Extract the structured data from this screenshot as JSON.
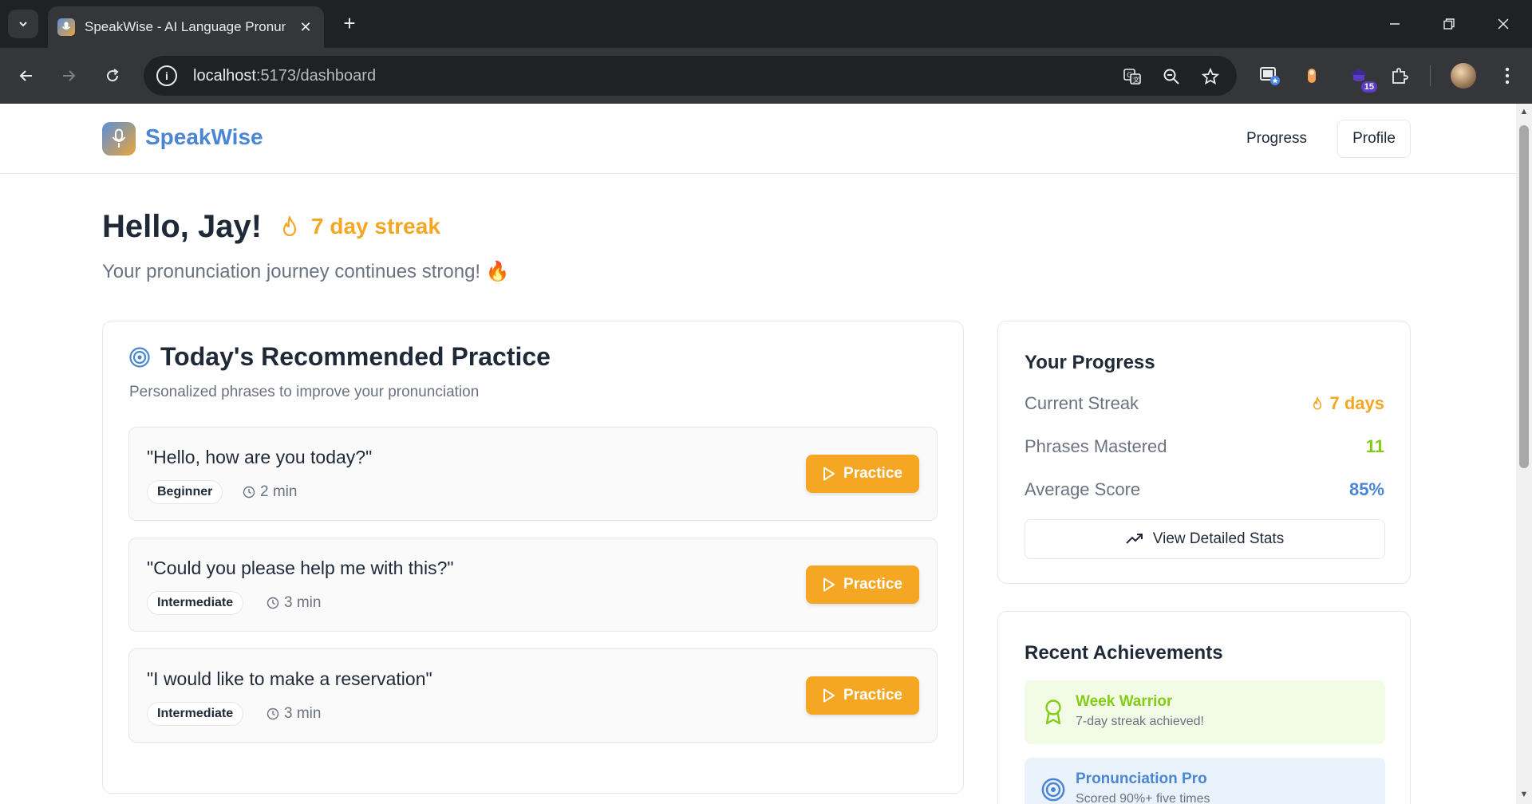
{
  "browser": {
    "tab_title": "SpeakWise - AI Language Pronunciation",
    "url_host": "localhost",
    "url_rest": ":5173/dashboard",
    "extension_badge": "15"
  },
  "header": {
    "brand": "SpeakWise",
    "nav": {
      "progress": "Progress",
      "profile": "Profile"
    }
  },
  "greeting": {
    "hello": "Hello, Jay!",
    "streak": "7 day streak",
    "subtitle": "Your pronunciation journey continues strong! 🔥"
  },
  "practice": {
    "title": "Today's Recommended Practice",
    "subtitle": "Personalized phrases to improve your pronunciation",
    "button_label": "Practice",
    "phrases": [
      {
        "text": "\"Hello, how are you today?\"",
        "level": "Beginner",
        "duration": "2 min"
      },
      {
        "text": "\"Could you please help me with this?\"",
        "level": "Intermediate",
        "duration": "3 min"
      },
      {
        "text": "\"I would like to make a reservation\"",
        "level": "Intermediate",
        "duration": "3 min"
      }
    ]
  },
  "progress": {
    "title": "Your Progress",
    "stats": [
      {
        "label": "Current Streak",
        "value": "7 days",
        "color": "#f5a623"
      },
      {
        "label": "Phrases Mastered",
        "value": "11",
        "color": "#84cc16"
      },
      {
        "label": "Average Score",
        "value": "85%",
        "color": "#4a86d4"
      }
    ],
    "details_button": "View Detailed Stats"
  },
  "achievements": {
    "title": "Recent Achievements",
    "items": [
      {
        "name": "Week Warrior",
        "desc": "7-day streak achieved!",
        "color": "#84cc16",
        "bg": "#f2fbe6",
        "icon": "award-icon"
      },
      {
        "name": "Pronunciation Pro",
        "desc": "Scored 90%+ five times",
        "color": "#4a86d4",
        "bg": "#eaf2fb",
        "icon": "target-icon"
      }
    ]
  },
  "colors": {
    "accent": "#f5a623",
    "brand": "#4a86d4",
    "success": "#84cc16"
  }
}
